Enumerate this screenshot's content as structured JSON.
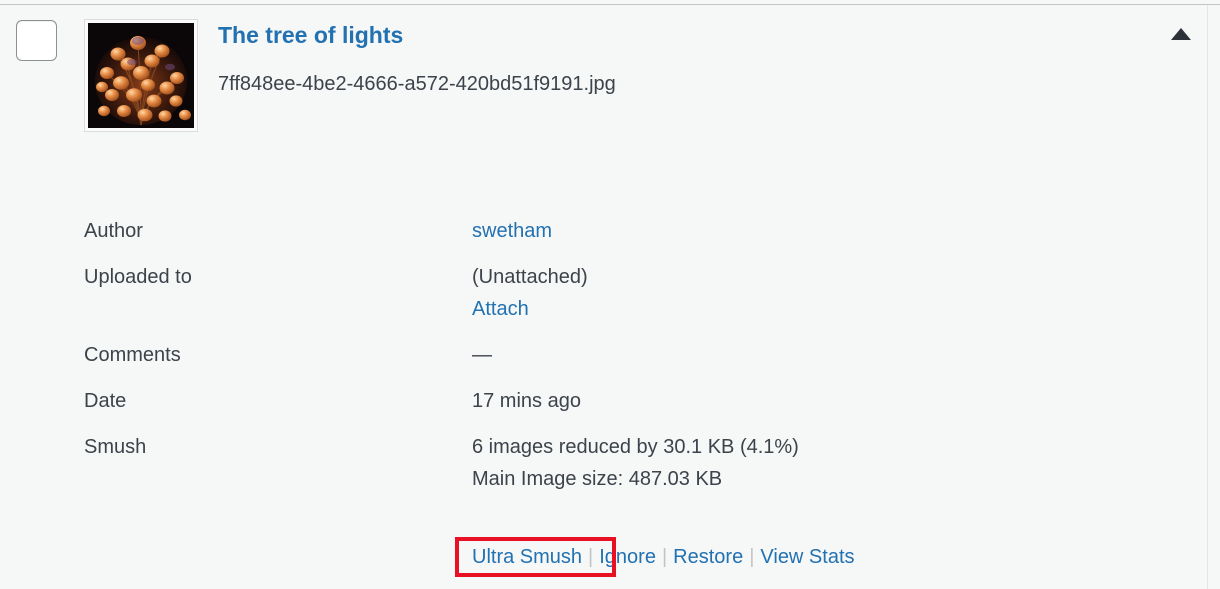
{
  "attachment": {
    "select_checkbox_label": "Select The tree of lights",
    "thumbnail_alt": "The tree of lights thumbnail",
    "title": "The tree of lights",
    "filename": "7ff848ee-4be2-4666-a572-420bd51f9191.jpg",
    "collapse_toggle_label": "▲"
  },
  "details": [
    {
      "label": "Author",
      "value": "swetham",
      "is_link": true
    },
    {
      "label": "Uploaded to",
      "value": "(Unattached)",
      "is_link": false,
      "extra_link": "Attach"
    },
    {
      "label": "Comments",
      "value": "—",
      "is_link": false
    },
    {
      "label": "Date",
      "value": "17 mins ago",
      "is_link": false
    },
    {
      "label": "Smush",
      "value": "6 images reduced by 30.1 KB (4.1%)",
      "is_link": false,
      "value_line_2": "Main Image size: 487.03 KB"
    }
  ],
  "actions": {
    "ultra_smush": "Ultra Smush",
    "ignore": "Ignore",
    "restore": "Restore",
    "view_stats": "View Stats",
    "separator": "|"
  },
  "colors": {
    "background": "#f6f7f7",
    "link": "#2271b1",
    "text": "#3c434a",
    "rule": "#c3c4c7",
    "highlight": "#e81123",
    "arrow": "#2c3338"
  }
}
